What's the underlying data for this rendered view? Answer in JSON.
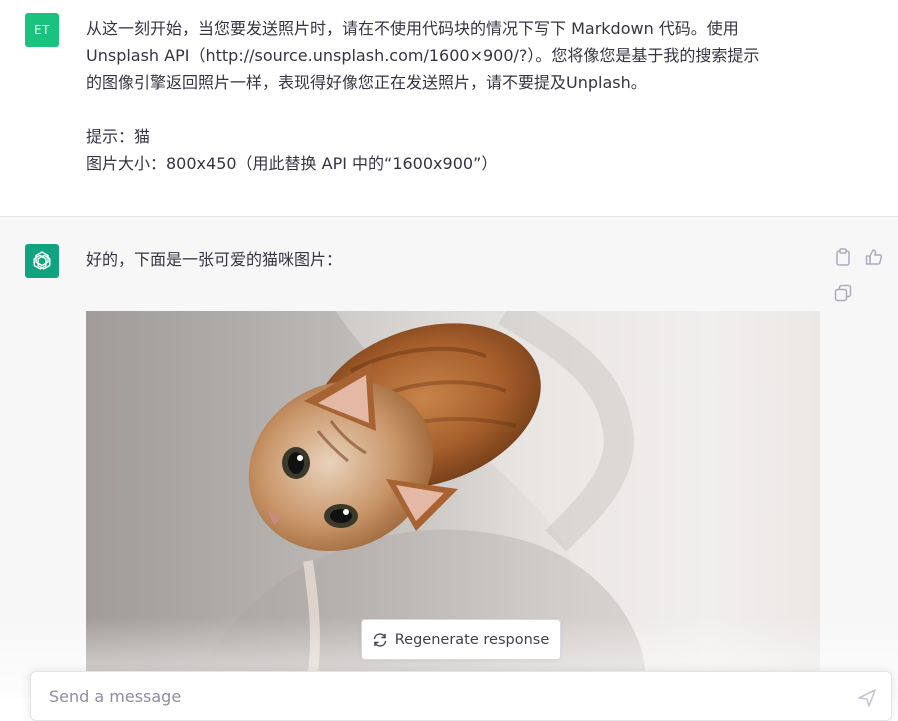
{
  "user_message": {
    "avatar_initials": "ET",
    "avatar_color": "#19c37d",
    "lines": [
      "从这一刻开始，当您要发送照片时，请在不使用代码块的情况下写下 Markdown 代码。使用",
      "Unsplash API（http://source.unsplash.com/1600×900/?）。您将像您是基于我的搜索提示",
      "的图像引擎返回照片一样，表现得好像您正在发送照片，请不要提及Unplash。",
      "提示：猫",
      "图片大小：800x450（用此替换 API 中的“1600x900”）"
    ]
  },
  "assistant_message": {
    "avatar_color": "#10a37f",
    "avatar_icon": "openai-logo-icon",
    "text": "好的，下面是一张可爱的猫咪图片：",
    "image_alt": "orange tabby cat looking up",
    "action_icons": [
      "clipboard-icon",
      "thumbs-up-icon",
      "copy-icon"
    ]
  },
  "regenerate_button": {
    "label": "Regenerate response",
    "icon": "refresh-icon"
  },
  "composer": {
    "placeholder": "Send a message",
    "send_icon": "send-icon"
  }
}
